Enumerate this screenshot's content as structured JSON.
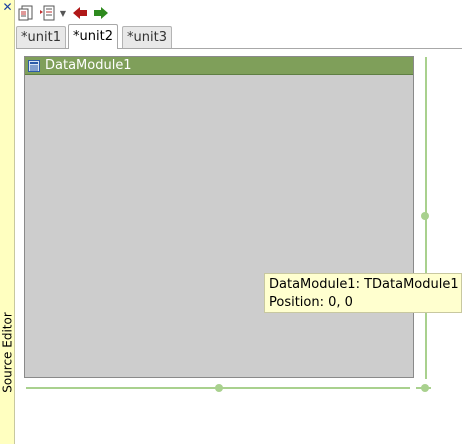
{
  "dock": {
    "title": "Source Editor",
    "close_icon": "close-icon",
    "accent_color": "#ffffc0"
  },
  "toolbar": {
    "buttons": [
      {
        "icon": "toggle-form-unit-icon"
      },
      {
        "icon": "jump-history-icon"
      },
      {
        "icon": "jump-back-icon"
      },
      {
        "icon": "jump-forward-icon"
      }
    ]
  },
  "tabs": [
    {
      "label": "*unit1",
      "active": false
    },
    {
      "label": "*unit2",
      "active": true
    },
    {
      "label": "*unit3",
      "active": false
    }
  ],
  "designer": {
    "module_name": "DataModule1",
    "title_color": "#7f9f5a",
    "surface_color": "#cdcdcd",
    "grip_color": "#a9d18e"
  },
  "tooltip": {
    "line1": "DataModule1: TDataModule1",
    "line2": "Position: 0, 0"
  }
}
